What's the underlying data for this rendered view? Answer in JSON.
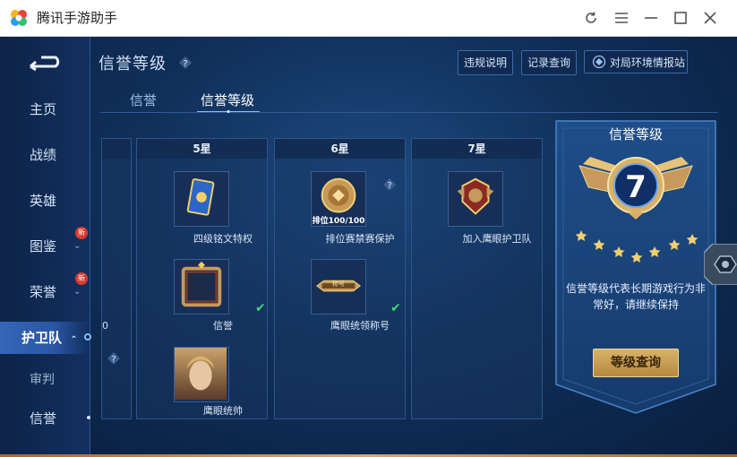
{
  "window": {
    "title": "腾讯手游助手"
  },
  "page": {
    "title": "信誉等级"
  },
  "top_buttons": {
    "rules": "违规说明",
    "records": "记录查询",
    "env": "对局环境情报站"
  },
  "tabs": [
    {
      "label": "信誉"
    },
    {
      "label": "信誉等级"
    }
  ],
  "sidebar": {
    "items": [
      {
        "label": "主页"
      },
      {
        "label": "战绩"
      },
      {
        "label": "英雄"
      },
      {
        "label": "图鉴",
        "badge": "新"
      },
      {
        "label": "荣誉",
        "badge": "新"
      },
      {
        "label": "护卫队"
      },
      {
        "label": "审判"
      },
      {
        "label": "信誉"
      }
    ]
  },
  "columns": [
    {
      "header": "5星",
      "items": [
        {
          "label": "四级铭文特权",
          "icon": "inscription-card-icon"
        },
        {
          "label": "信誉",
          "icon": "avatar-frame-icon",
          "checked": true
        },
        {
          "label": "鹰眼统帅",
          "icon": "hero-portrait-icon"
        }
      ]
    },
    {
      "header": "6星",
      "items": [
        {
          "label": "排位赛禁赛保护",
          "icon": "ranked-protect-icon",
          "overlay": "排位100/100"
        },
        {
          "label": "鹰眼统领称号",
          "icon": "title-plate-icon",
          "overlay": "称号",
          "checked": true
        }
      ]
    },
    {
      "header": "7星",
      "items": [
        {
          "label": "加入鹰眼护卫队",
          "icon": "guard-badge-icon"
        }
      ]
    }
  ],
  "rank": {
    "title": "信誉等级",
    "level": "7",
    "description": "信誉等级代表长期游戏行为非常好，请继续保持",
    "query_button": "等级查询"
  },
  "left_partial_value": "0",
  "colors": {
    "accent_gold": "#d7b26a",
    "check_green": "#43d17a",
    "badge_red": "#d83b2d",
    "panel_blue": "#10305a"
  }
}
